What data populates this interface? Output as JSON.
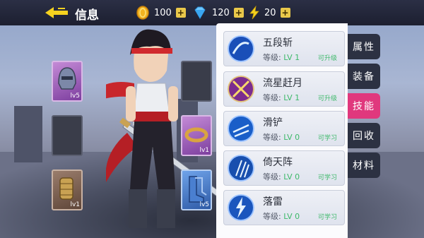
{
  "header": {
    "title": "信息",
    "resources": [
      {
        "icon": "gold-coin-icon",
        "value": "100"
      },
      {
        "icon": "diamond-icon",
        "value": "120"
      },
      {
        "icon": "lightning-energy-icon",
        "value": "20"
      }
    ],
    "plus_label": "+"
  },
  "equipment": {
    "left": [
      {
        "item": "helmet",
        "level": "lv5",
        "rarity": "purple"
      },
      {
        "item": "empty",
        "level": "",
        "rarity": "empty"
      },
      {
        "item": "bracer",
        "level": "lv1",
        "rarity": "brown"
      }
    ],
    "right": [
      {
        "item": "empty",
        "level": "",
        "rarity": "empty"
      },
      {
        "item": "ring",
        "level": "lv1",
        "rarity": "purple"
      },
      {
        "item": "boots",
        "level": "lv5",
        "rarity": "blue"
      }
    ]
  },
  "skills": [
    {
      "name": "五段斩",
      "level_label": "等级:",
      "level": "LV 1",
      "status": "可升级",
      "icon": "blue-slash-skill-icon"
    },
    {
      "name": "流星赶月",
      "level_label": "等级:",
      "level": "LV 1",
      "status": "可升级",
      "icon": "meteor-cross-skill-icon"
    },
    {
      "name": "滑铲",
      "level_label": "等级:",
      "level": "LV 0",
      "status": "可学习",
      "icon": "slide-skill-icon"
    },
    {
      "name": "倚天阵",
      "level_label": "等级:",
      "level": "LV 0",
      "status": "可学习",
      "icon": "sword-array-skill-icon"
    },
    {
      "name": "落雷",
      "level_label": "等级:",
      "level": "LV 0",
      "status": "可学习",
      "icon": "lightning-strike-skill-icon"
    }
  ],
  "tabs": [
    {
      "label": "属性",
      "active": false
    },
    {
      "label": "装备",
      "active": false
    },
    {
      "label": "技能",
      "active": true
    },
    {
      "label": "回收",
      "active": false
    },
    {
      "label": "材料",
      "active": false
    }
  ],
  "colors": {
    "accent": "#e0387d",
    "learnable": "#3eb96a",
    "topbar": "#1c1f30"
  }
}
